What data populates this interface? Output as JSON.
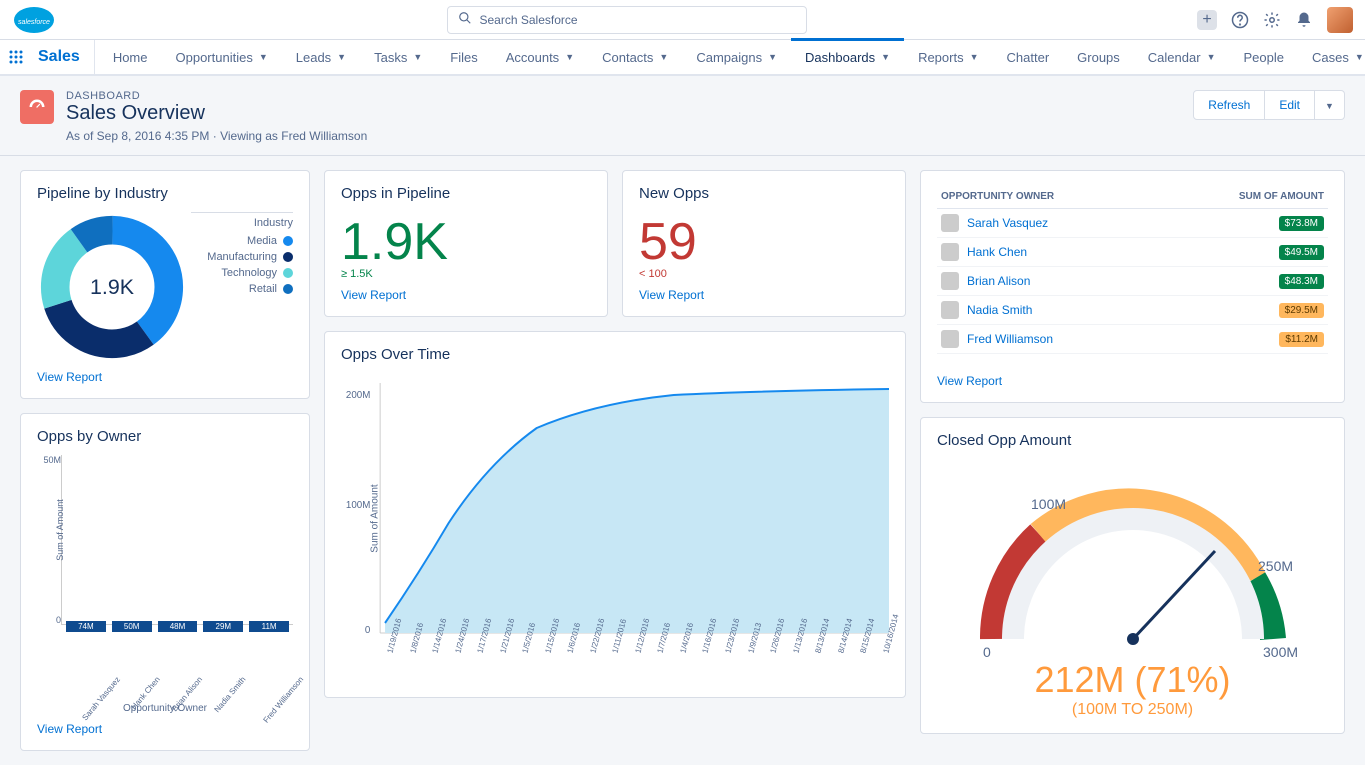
{
  "header": {
    "search_placeholder": "Search Salesforce"
  },
  "nav": {
    "app_name": "Sales",
    "items": [
      {
        "label": "Home",
        "dd": false
      },
      {
        "label": "Opportunities",
        "dd": true
      },
      {
        "label": "Leads",
        "dd": true
      },
      {
        "label": "Tasks",
        "dd": true
      },
      {
        "label": "Files",
        "dd": false
      },
      {
        "label": "Accounts",
        "dd": true
      },
      {
        "label": "Contacts",
        "dd": true
      },
      {
        "label": "Campaigns",
        "dd": true
      },
      {
        "label": "Dashboards",
        "dd": true,
        "active": true
      },
      {
        "label": "Reports",
        "dd": true
      },
      {
        "label": "Chatter",
        "dd": false
      },
      {
        "label": "Groups",
        "dd": false
      },
      {
        "label": "Calendar",
        "dd": true
      },
      {
        "label": "People",
        "dd": false
      },
      {
        "label": "Cases",
        "dd": true
      }
    ]
  },
  "page": {
    "label": "DASHBOARD",
    "title": "Sales Overview",
    "subtitle": "As of Sep 8, 2016 4:35 PM · Viewing as Fred Williamson",
    "refresh": "Refresh",
    "edit": "Edit"
  },
  "labels": {
    "view_report": "View Report"
  },
  "pipeline_industry": {
    "title": "Pipeline by Industry",
    "center": "1.9K",
    "legend_title": "Industry",
    "legend": [
      {
        "label": "Media",
        "color": "#1589ee"
      },
      {
        "label": "Manufacturing",
        "color": "#0a2d6b"
      },
      {
        "label": "Technology",
        "color": "#5dd5da"
      },
      {
        "label": "Retail",
        "color": "#0f6fbf"
      }
    ]
  },
  "opps_pipeline": {
    "title": "Opps in Pipeline",
    "value": "1.9K",
    "note": "≥ 1.5K"
  },
  "new_opps": {
    "title": "New Opps",
    "value": "59",
    "note": "< 100"
  },
  "opps_by_owner": {
    "title": "Opps by Owner",
    "x_title": "Opportunity Owner",
    "y_title": "Sum of Amount",
    "y_ticks": [
      "50M",
      "0"
    ],
    "bars": [
      {
        "label": "Sarah Vasquez",
        "val_label": "74M",
        "h": 74
      },
      {
        "label": "Hank Chen",
        "val_label": "50M",
        "h": 50
      },
      {
        "label": "Brian Alison",
        "val_label": "48M",
        "h": 48
      },
      {
        "label": "Nadia Smith",
        "val_label": "29M",
        "h": 29
      },
      {
        "label": "Fred Williamson",
        "val_label": "11M",
        "h": 11
      }
    ]
  },
  "opps_over_time": {
    "title": "Opps Over Time",
    "y_title": "Sum of Amount",
    "y_ticks": [
      "200M",
      "100M",
      "0"
    ],
    "x_labels": [
      "1/19/2016",
      "1/8/2016",
      "1/14/2016",
      "1/24/2016",
      "1/17/2016",
      "1/21/2016",
      "1/5/2016",
      "1/15/2016",
      "1/6/2016",
      "1/22/2016",
      "1/11/2016",
      "1/12/2016",
      "1/7/2016",
      "1/4/2016",
      "1/16/2016",
      "1/23/2016",
      "1/9/2013",
      "1/26/2016",
      "1/13/2016",
      "8/13/2014",
      "8/14/2014",
      "8/15/2014",
      "10/16/2014"
    ]
  },
  "owner_table": {
    "col1": "OPPORTUNITY OWNER",
    "col2": "SUM OF AMOUNT",
    "rows": [
      {
        "name": "Sarah Vasquez",
        "amt": "$73.8M",
        "green": true
      },
      {
        "name": "Hank Chen",
        "amt": "$49.5M",
        "green": true
      },
      {
        "name": "Brian Alison",
        "amt": "$48.3M",
        "green": true
      },
      {
        "name": "Nadia Smith",
        "amt": "$29.5M",
        "green": false
      },
      {
        "name": "Fred Williamson",
        "amt": "$11.2M",
        "green": false
      }
    ]
  },
  "closed_opp": {
    "title": "Closed Opp Amount",
    "tick_0": "0",
    "tick_100": "100M",
    "tick_250": "250M",
    "tick_300": "300M",
    "value": "212M (71%)",
    "sub": "(100M TO 250M)"
  },
  "chart_data": [
    {
      "type": "pie",
      "title": "Pipeline by Industry",
      "total_label": "1.9K",
      "series": [
        {
          "name": "Media",
          "value": 760,
          "color": "#1589ee"
        },
        {
          "name": "Manufacturing",
          "value": 570,
          "color": "#0a2d6b"
        },
        {
          "name": "Technology",
          "value": 380,
          "color": "#5dd5da"
        },
        {
          "name": "Retail",
          "value": 190,
          "color": "#0f6fbf"
        }
      ]
    },
    {
      "type": "bar",
      "title": "Opps by Owner",
      "xlabel": "Opportunity Owner",
      "ylabel": "Sum of Amount",
      "ylim": [
        0,
        80
      ],
      "categories": [
        "Sarah Vasquez",
        "Hank Chen",
        "Brian Alison",
        "Nadia Smith",
        "Fred Williamson"
      ],
      "values": [
        74,
        50,
        48,
        29,
        11
      ],
      "unit": "M"
    },
    {
      "type": "area",
      "title": "Opps Over Time",
      "ylabel": "Sum of Amount",
      "ylim": [
        0,
        220
      ],
      "unit": "M",
      "x": [
        "1/19/2016",
        "1/8/2016",
        "1/14/2016",
        "1/24/2016",
        "1/17/2016",
        "1/21/2016",
        "1/5/2016",
        "1/15/2016",
        "1/6/2016",
        "1/22/2016",
        "1/11/2016",
        "1/12/2016",
        "1/7/2016",
        "1/4/2016",
        "1/16/2016",
        "1/23/2016",
        "1/9/2013",
        "1/26/2016",
        "1/13/2016",
        "8/13/2014",
        "8/14/2014",
        "8/15/2014",
        "10/16/2014"
      ],
      "values": [
        10,
        40,
        70,
        100,
        125,
        145,
        160,
        172,
        182,
        190,
        197,
        202,
        206,
        209,
        211,
        213,
        214,
        215,
        216,
        216,
        216,
        217,
        217
      ]
    },
    {
      "type": "table",
      "title": "Opportunity Owner / Sum of Amount",
      "columns": [
        "OPPORTUNITY OWNER",
        "SUM OF AMOUNT"
      ],
      "rows": [
        [
          "Sarah Vasquez",
          "$73.8M"
        ],
        [
          "Hank Chen",
          "$49.5M"
        ],
        [
          "Brian Alison",
          "$48.3M"
        ],
        [
          "Nadia Smith",
          "$29.5M"
        ],
        [
          "Fred Williamson",
          "$11.2M"
        ]
      ]
    },
    {
      "type": "gauge",
      "title": "Closed Opp Amount",
      "min": 0,
      "max": 300,
      "unit": "M",
      "ranges": [
        {
          "from": 0,
          "to": 100,
          "color": "#c23934"
        },
        {
          "from": 100,
          "to": 250,
          "color": "#ffb75d"
        },
        {
          "from": 250,
          "to": 300,
          "color": "#04844b"
        }
      ],
      "value": 212,
      "percent": 71,
      "target_range": [
        100,
        250
      ]
    }
  ]
}
